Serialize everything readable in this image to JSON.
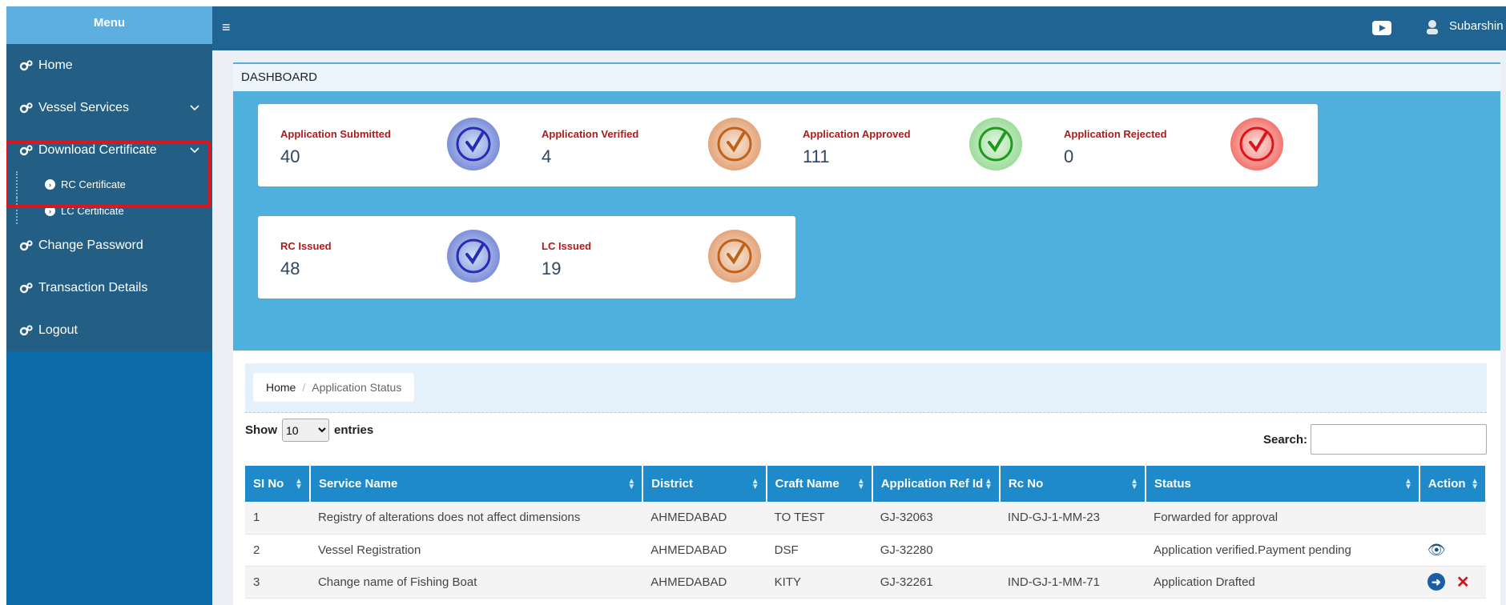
{
  "sidebar": {
    "title": "Menu",
    "items": [
      {
        "label": "Home",
        "icon": "gears-icon"
      },
      {
        "label": "Vessel Services",
        "icon": "gears-icon",
        "chevron": "chevron-down-icon"
      },
      {
        "label": "Download Certificate",
        "icon": "gears-icon",
        "chevron": "chevron-down-icon",
        "sub": [
          "RC Certificate",
          "LC Certificate"
        ]
      },
      {
        "label": "Change Password",
        "icon": "gears-icon"
      },
      {
        "label": "Transaction Details",
        "icon": "gears-icon"
      },
      {
        "label": "Logout",
        "icon": "gears-icon"
      }
    ]
  },
  "topbar": {
    "menu_icon": "≡",
    "user_name": "Subarshin"
  },
  "dashboard": {
    "title": "DASHBOARD",
    "cards": [
      {
        "label": "Application Submitted",
        "value": "40",
        "color": "#2a2ab5"
      },
      {
        "label": "Application Verified",
        "value": "4",
        "color": "#c0621a"
      },
      {
        "label": "Application Approved",
        "value": "111",
        "color": "#1f9a1f"
      },
      {
        "label": "Application Rejected",
        "value": "0",
        "color": "#e0141b"
      },
      {
        "label": "RC Issued",
        "value": "48",
        "color": "#2a2ab5"
      },
      {
        "label": "LC Issued",
        "value": "19",
        "color": "#c0621a"
      }
    ]
  },
  "breadcrumb": {
    "home": "Home",
    "current": "Application Status"
  },
  "table_controls": {
    "show_label": "Show",
    "entries_value": "10",
    "entries_label": "entries",
    "search_label": "Search:"
  },
  "table": {
    "columns": [
      "SI No",
      "Service Name",
      "District",
      "Craft Name",
      "Application Ref Id",
      "Rc No",
      "Status",
      "Action"
    ],
    "rows": [
      {
        "si": "1",
        "service": "Registry of alterations does not affect dimensions",
        "district": "AHMEDABAD",
        "craft": "TO TEST",
        "ref": "GJ-32063",
        "rc": "IND-GJ-1-MM-23",
        "status": "Forwarded for approval",
        "actions": []
      },
      {
        "si": "2",
        "service": "Vessel Registration",
        "district": "AHMEDABAD",
        "craft": "DSF",
        "ref": "GJ-32280",
        "rc": "",
        "status": "Application verified.Payment pending",
        "actions": [
          "view"
        ]
      },
      {
        "si": "3",
        "service": "Change name of Fishing Boat",
        "district": "AHMEDABAD",
        "craft": "KITY",
        "ref": "GJ-32261",
        "rc": "IND-GJ-1-MM-71",
        "status": "Application Drafted",
        "actions": [
          "proceed",
          "delete"
        ]
      }
    ]
  }
}
